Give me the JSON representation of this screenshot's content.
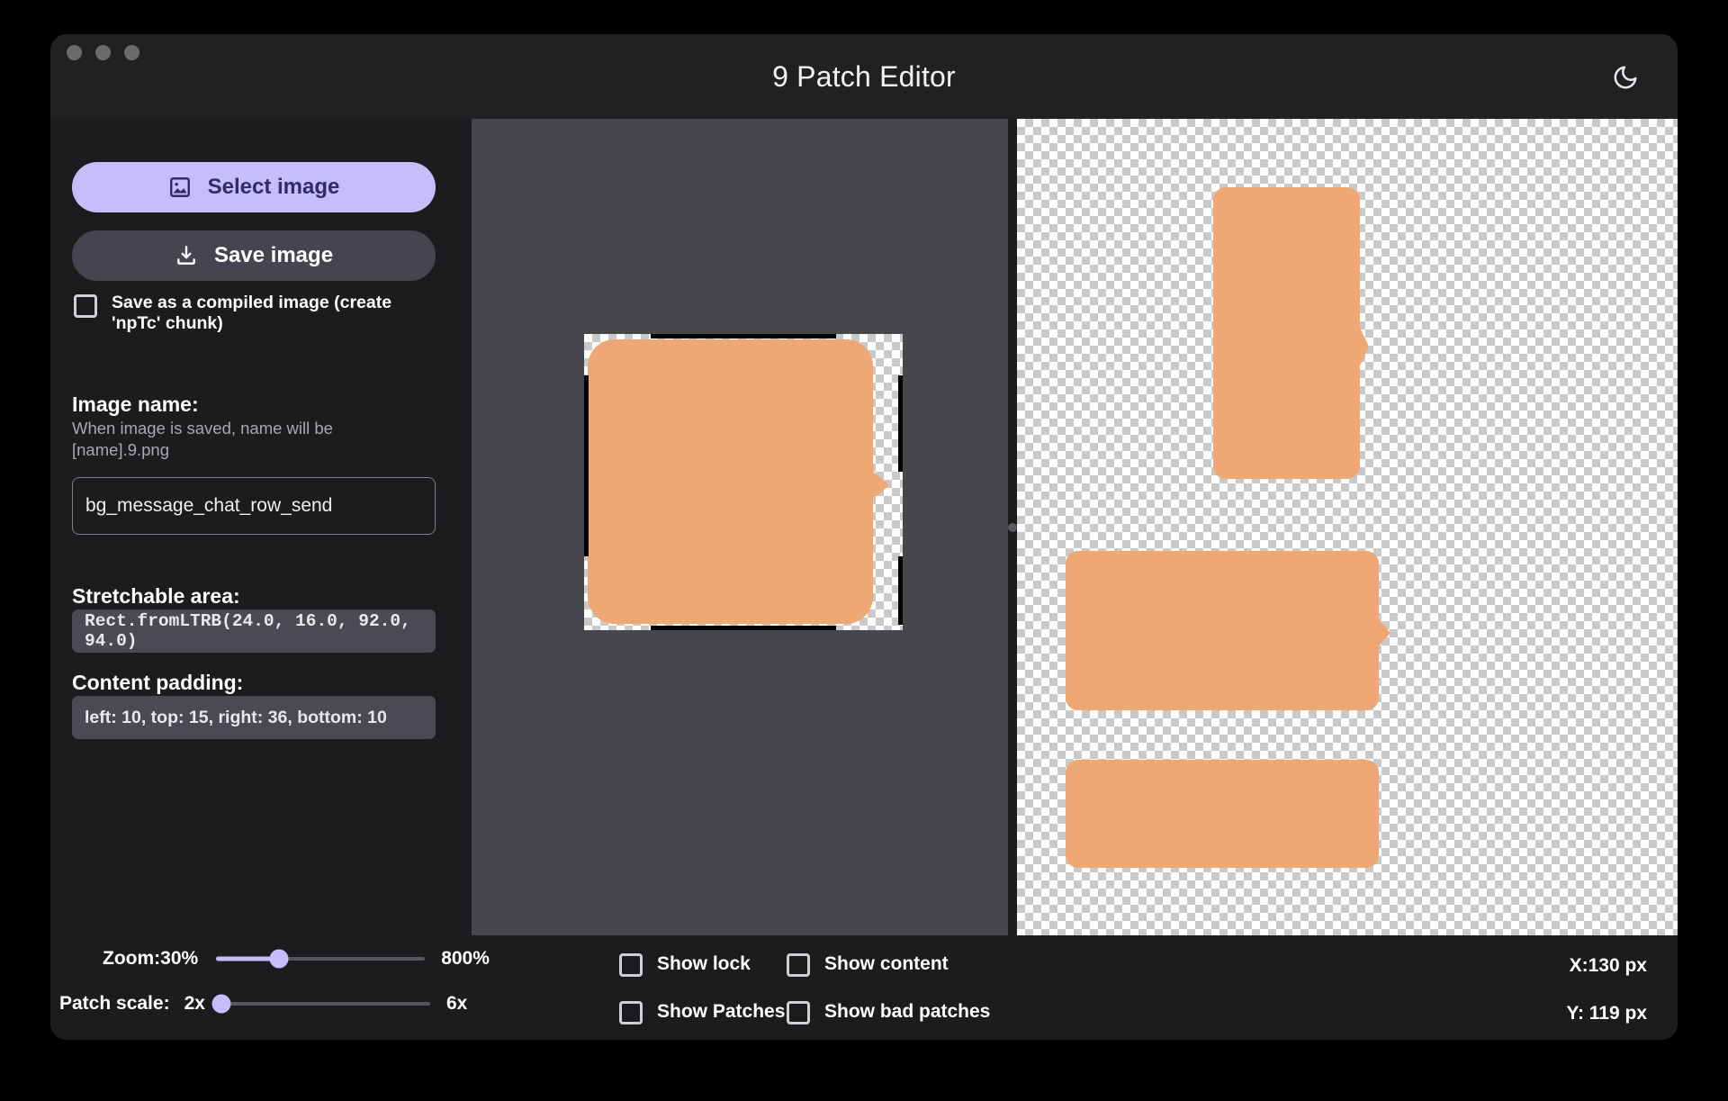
{
  "window": {
    "title": "9 Patch Editor",
    "traffic_lights": [
      "close",
      "minimize",
      "maximize"
    ],
    "theme_toggle_icon": "moon-icon"
  },
  "sidebar": {
    "select_image_label": "Select image",
    "select_image_icon": "image-icon",
    "save_image_label": "Save image",
    "save_image_icon": "download-icon",
    "compiled_checkbox_label": "Save as a compiled image (create 'npTc' chunk)",
    "compiled_checkbox_checked": false,
    "image_name_heading": "Image name:",
    "image_name_hint": "When image is saved, name will be [name].9.png",
    "image_name_value": "bg_message_chat_row_send",
    "image_name_placeholder": "bg_message_chat_row_send",
    "stretchable_heading": "Stretchable area:",
    "stretchable_value": "Rect.fromLTRB(24.0, 16.0, 92.0, 94.0)",
    "content_padding_heading": "Content padding:",
    "content_padding_value": "left: 10, top: 15, right: 36, bottom: 10"
  },
  "bottom_bar": {
    "zoom_label": "Zoom:30%",
    "zoom_max_label": "800%",
    "zoom_percent": 30,
    "patch_scale_label": "Patch scale:",
    "patch_scale_value": "2x",
    "patch_scale_max_label": "6x",
    "patch_scale_percent": 0,
    "checkboxes": [
      {
        "label": "Show lock",
        "checked": false
      },
      {
        "label": "Show content",
        "checked": false
      },
      {
        "label": "Show Patches",
        "checked": false
      },
      {
        "label": "Show bad patches",
        "checked": false
      }
    ],
    "coord_x": "X:130 px",
    "coord_y": "Y: 119 px"
  },
  "colors": {
    "accent": "#c7bdfb",
    "accent_text": "#2f2b6d",
    "surface": "#1c1c1e",
    "canvas_bg": "#46464c",
    "field_bg": "#4a4a53",
    "patch_orange": "#efa773"
  }
}
